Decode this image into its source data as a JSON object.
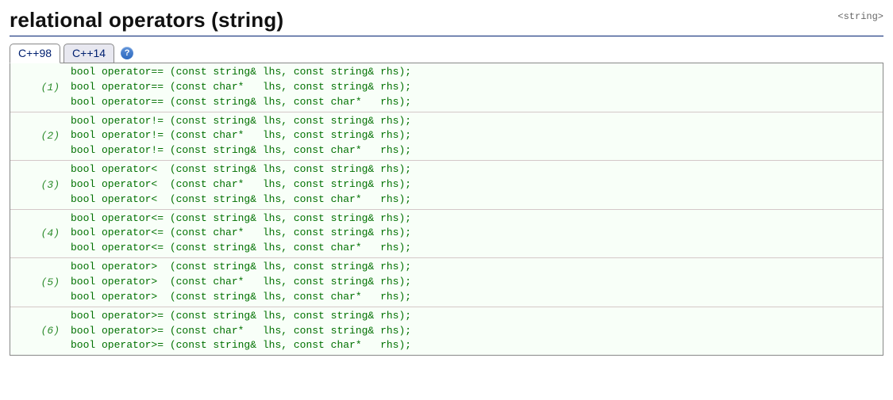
{
  "header": {
    "title": "relational operators (string)",
    "scope": "<string>"
  },
  "tabs": {
    "items": [
      {
        "label": "C++98",
        "active": true
      },
      {
        "label": "C++14",
        "active": false
      }
    ],
    "help_label": "?"
  },
  "prototypes": {
    "groups": [
      {
        "num": "(1)",
        "lines": [
          "bool operator== (const string& lhs, const string& rhs);",
          "bool operator== (const char*   lhs, const string& rhs);",
          "bool operator== (const string& lhs, const char*   rhs);"
        ]
      },
      {
        "num": "(2)",
        "lines": [
          "bool operator!= (const string& lhs, const string& rhs);",
          "bool operator!= (const char*   lhs, const string& rhs);",
          "bool operator!= (const string& lhs, const char*   rhs);"
        ]
      },
      {
        "num": "(3)",
        "lines": [
          "bool operator<  (const string& lhs, const string& rhs);",
          "bool operator<  (const char*   lhs, const string& rhs);",
          "bool operator<  (const string& lhs, const char*   rhs);"
        ]
      },
      {
        "num": "(4)",
        "lines": [
          "bool operator<= (const string& lhs, const string& rhs);",
          "bool operator<= (const char*   lhs, const string& rhs);",
          "bool operator<= (const string& lhs, const char*   rhs);"
        ]
      },
      {
        "num": "(5)",
        "lines": [
          "bool operator>  (const string& lhs, const string& rhs);",
          "bool operator>  (const char*   lhs, const string& rhs);",
          "bool operator>  (const string& lhs, const char*   rhs);"
        ]
      },
      {
        "num": "(6)",
        "lines": [
          "bool operator>= (const string& lhs, const string& rhs);",
          "bool operator>= (const char*   lhs, const string& rhs);",
          "bool operator>= (const string& lhs, const char*   rhs);"
        ]
      }
    ]
  }
}
